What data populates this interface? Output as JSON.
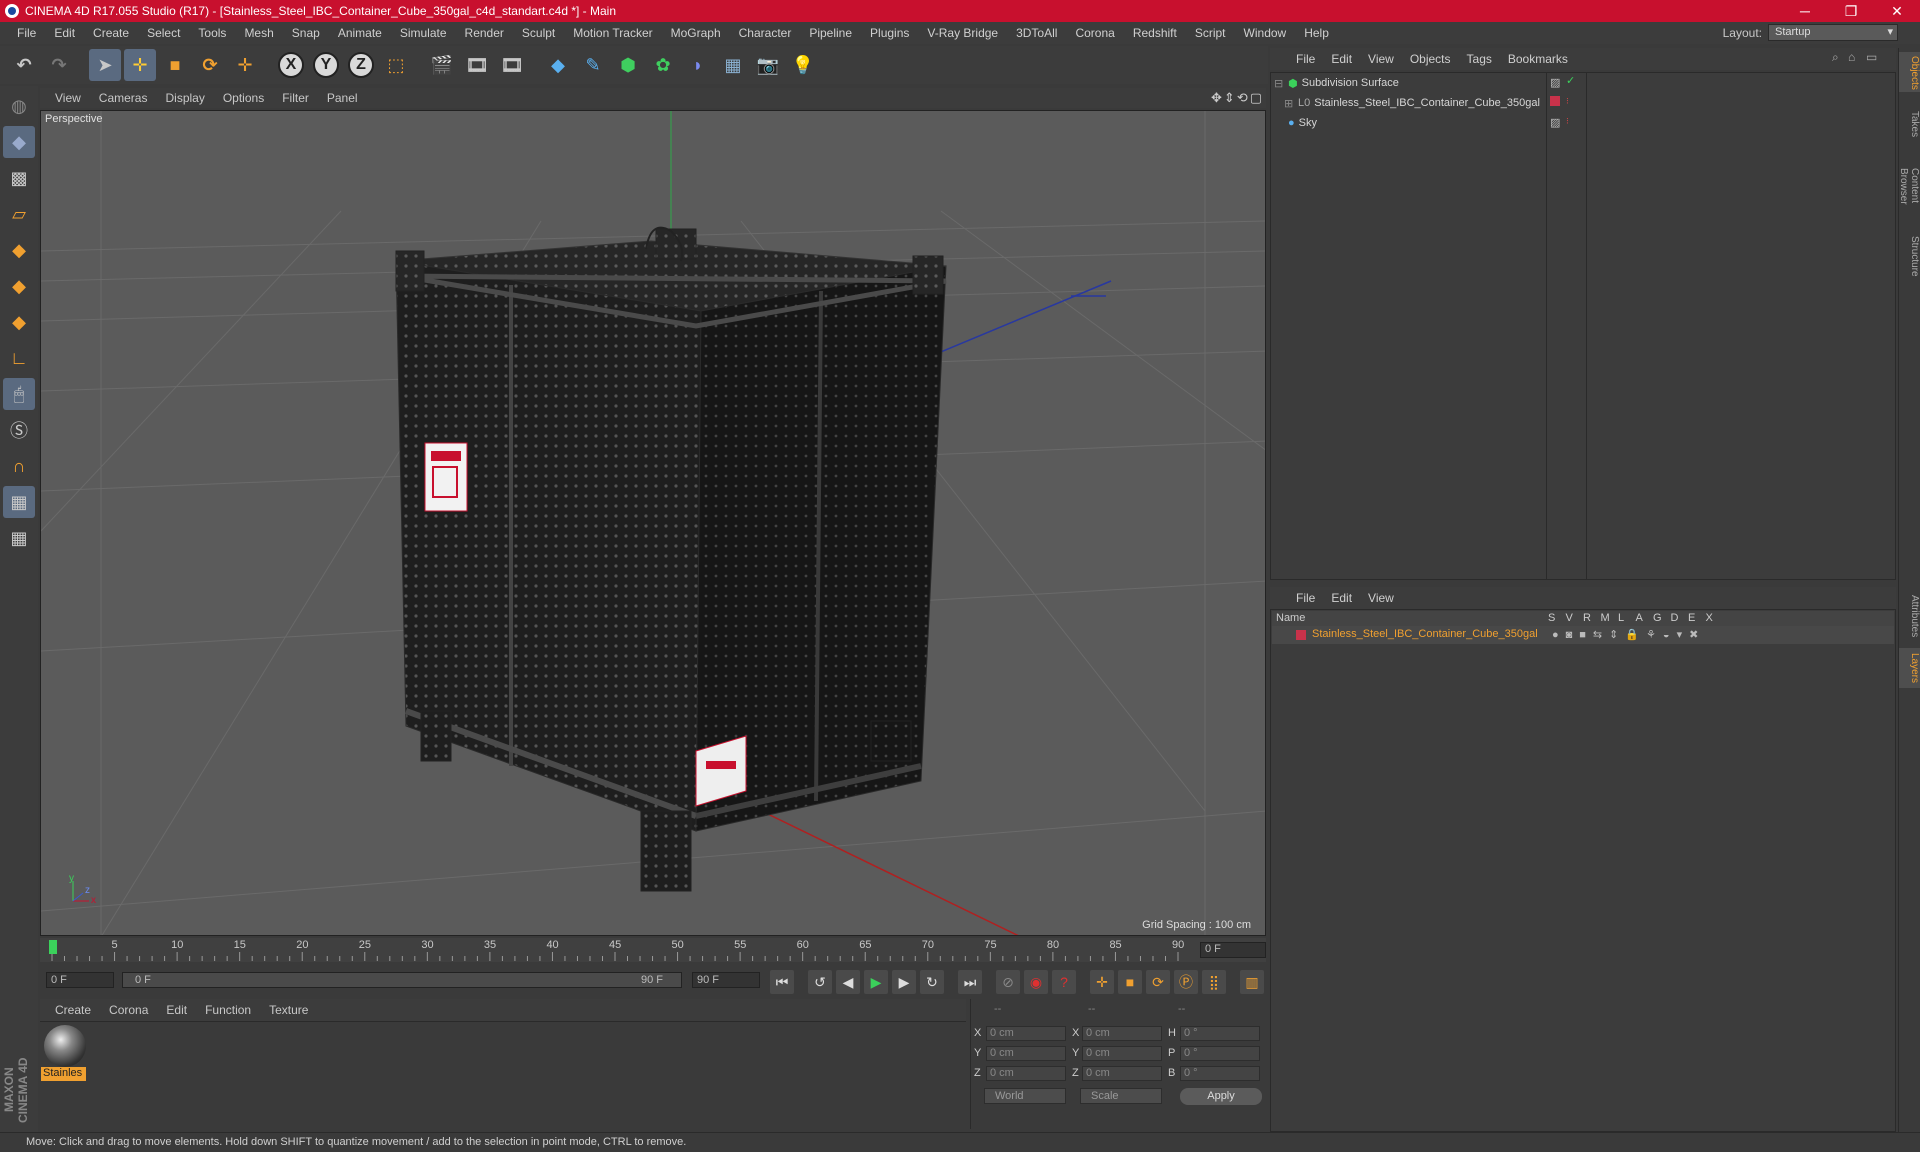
{
  "window": {
    "title": "CINEMA 4D R17.055 Studio (R17) - [Stainless_Steel_IBC_Container_Cube_350gal_c4d_standart.c4d *] - Main",
    "minimize": "─",
    "maximize": "❐",
    "close": "✕"
  },
  "menubar": {
    "items": [
      "File",
      "Edit",
      "Create",
      "Select",
      "Tools",
      "Mesh",
      "Snap",
      "Animate",
      "Simulate",
      "Render",
      "Sculpt",
      "Motion Tracker",
      "MoGraph",
      "Character",
      "Pipeline",
      "Plugins",
      "V-Ray Bridge",
      "3DToAll",
      "Corona",
      "Redshift",
      "Script",
      "Window",
      "Help"
    ],
    "layout_label": "Layout:",
    "layout_value": "Startup"
  },
  "viewport": {
    "menu": [
      "View",
      "Cameras",
      "Display",
      "Options",
      "Filter",
      "Panel"
    ],
    "label": "Perspective",
    "grid_spacing": "Grid Spacing : 100 cm",
    "nav_icons": "✥⇕⟲▢"
  },
  "timeline": {
    "ticks": [
      "0",
      "5",
      "10",
      "15",
      "20",
      "25",
      "30",
      "35",
      "40",
      "45",
      "50",
      "55",
      "60",
      "65",
      "70",
      "75",
      "80",
      "85",
      "90"
    ],
    "current_frame": "0 F"
  },
  "transport": {
    "start_field": "0 F",
    "range_start": "0 F",
    "range_end": "90 F",
    "end_field": "90 F"
  },
  "material_manager": {
    "menu": [
      "Create",
      "Corona",
      "Edit",
      "Function",
      "Texture"
    ],
    "materials": [
      {
        "label": "Stainles"
      }
    ]
  },
  "coordinates": {
    "header": [
      "--",
      "--",
      "--"
    ],
    "rows": [
      {
        "a": "X",
        "av": "0 cm",
        "b": "X",
        "bv": "0 cm",
        "c": "H",
        "cv": "0 °"
      },
      {
        "a": "Y",
        "av": "0 cm",
        "b": "Y",
        "bv": "0 cm",
        "c": "P",
        "cv": "0 °"
      },
      {
        "a": "Z",
        "av": "0 cm",
        "b": "Z",
        "bv": "0 cm",
        "c": "B",
        "cv": "0 °"
      }
    ],
    "mode_world": "World",
    "mode_scale": "Scale",
    "apply": "Apply"
  },
  "object_manager": {
    "menu": [
      "File",
      "Edit",
      "View",
      "Objects",
      "Tags",
      "Bookmarks"
    ],
    "objects": [
      {
        "name": "Subdivision Surface",
        "indent": 0
      },
      {
        "name": "Stainless_Steel_IBC_Container_Cube_350gal",
        "indent": 1
      },
      {
        "name": "Sky",
        "indent": 0
      }
    ]
  },
  "layer_manager": {
    "menu": [
      "File",
      "Edit",
      "View"
    ],
    "columns": [
      "Name",
      "S",
      "V",
      "R",
      "M",
      "L",
      "A",
      "G",
      "D",
      "E",
      "X"
    ],
    "layers": [
      {
        "name": "Stainless_Steel_IBC_Container_Cube_350gal",
        "color": "#c8324a"
      }
    ]
  },
  "side_tabs": [
    "Objects",
    "Takes",
    "Content Browser",
    "Structure",
    "Attributes",
    "Layers"
  ],
  "status": "Move: Click and drag to move elements. Hold down SHIFT to quantize movement / add to the selection in point mode, CTRL to remove.",
  "brand": "MAXON CINEMA 4D",
  "colors": {
    "titlebar": "#c8102e",
    "accent_orange": "#f0a030",
    "selection_blue": "#5a6a80",
    "playhead_green": "#3bd15b"
  }
}
